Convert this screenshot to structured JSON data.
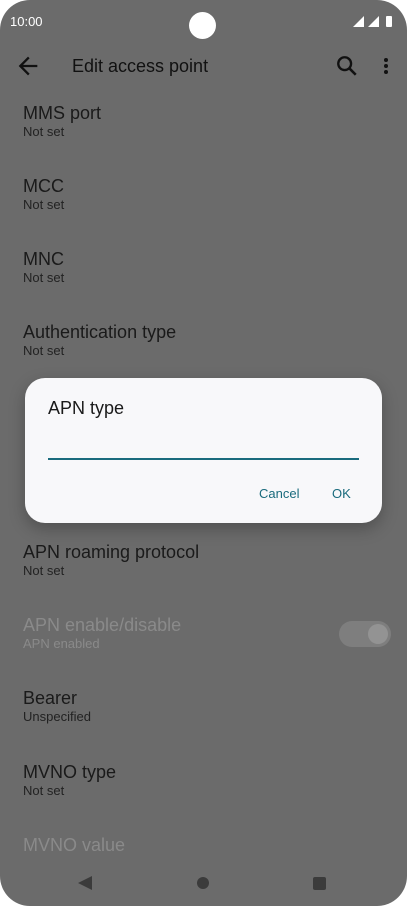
{
  "status_bar": {
    "time": "10:00"
  },
  "app_bar": {
    "title": "Edit access point"
  },
  "list": {
    "items": [
      {
        "title": "MMS port",
        "subtitle": "Not set"
      },
      {
        "title": "MCC",
        "subtitle": "Not set"
      },
      {
        "title": "MNC",
        "subtitle": "Not set"
      },
      {
        "title": "Authentication type",
        "subtitle": "Not set"
      },
      {
        "title": "APN roaming protocol",
        "subtitle": "Not set"
      },
      {
        "title": "APN enable/disable",
        "subtitle": "APN enabled",
        "disabled": true,
        "toggle_on": true
      },
      {
        "title": "Bearer",
        "subtitle": "Unspecified"
      },
      {
        "title": "MVNO type",
        "subtitle": "Not set"
      },
      {
        "title": "MVNO value",
        "subtitle": "",
        "disabled": true
      }
    ]
  },
  "dialog": {
    "title": "APN type",
    "input_value": "",
    "cancel_label": "Cancel",
    "ok_label": "OK"
  },
  "colors": {
    "accent": "#1a6b7d",
    "scrim_background": "#6b6b6b",
    "dialog_background": "#f8f8fa"
  },
  "icons": {
    "back": "arrow-left-icon",
    "search": "search-icon",
    "menu": "more-vert-icon"
  }
}
